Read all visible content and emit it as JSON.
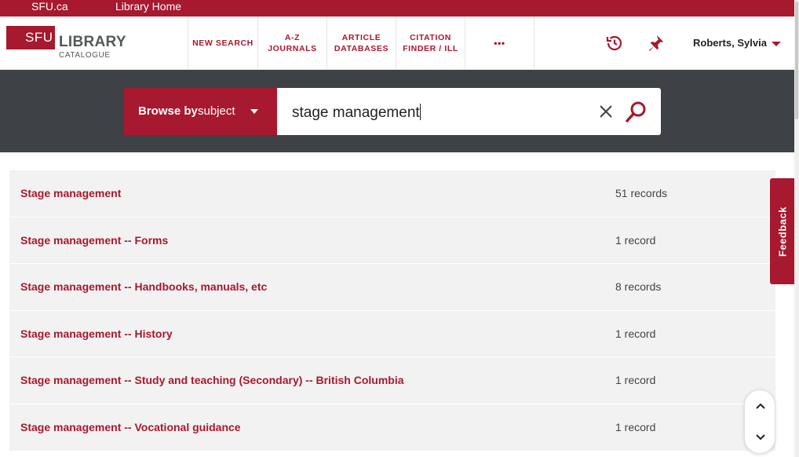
{
  "topbar": {
    "sfu_link": "SFU.ca",
    "library_home_link": "Library Home"
  },
  "logo": {
    "sfu": "SFU",
    "library": "LIBRARY",
    "catalogue": "CATALOGUE"
  },
  "nav": {
    "new_search": "NEW SEARCH",
    "az_journals_l1": "A-Z",
    "az_journals_l2": "JOURNALS",
    "article_db_l1": "ARTICLE",
    "article_db_l2": "DATABASES",
    "citation_l1": "CITATION",
    "citation_l2": "FINDER / ILL",
    "more": "•••"
  },
  "header_icons": [
    "history-icon",
    "pin-icon"
  ],
  "user": {
    "name": "Roberts, Sylvia"
  },
  "search": {
    "browse_label": "Browse by",
    "browse_value": "subject",
    "query": "stage management"
  },
  "results": [
    {
      "term": "Stage management",
      "count": "51 records"
    },
    {
      "term": "Stage management -- Forms",
      "count": "1 record"
    },
    {
      "term": "Stage management -- Handbooks, manuals, etc",
      "count": "8 records"
    },
    {
      "term": "Stage management -- History",
      "count": "1 record"
    },
    {
      "term": "Stage management -- Study and teaching (Secondary) -- British Columbia",
      "count": "1 record"
    },
    {
      "term": "Stage management -- Vocational guidance",
      "count": "1 record"
    }
  ],
  "feedback": {
    "label": "Feedback"
  },
  "colors": {
    "brand": "#a6192e",
    "band": "#3e4146",
    "row": "#f2f2f2"
  }
}
